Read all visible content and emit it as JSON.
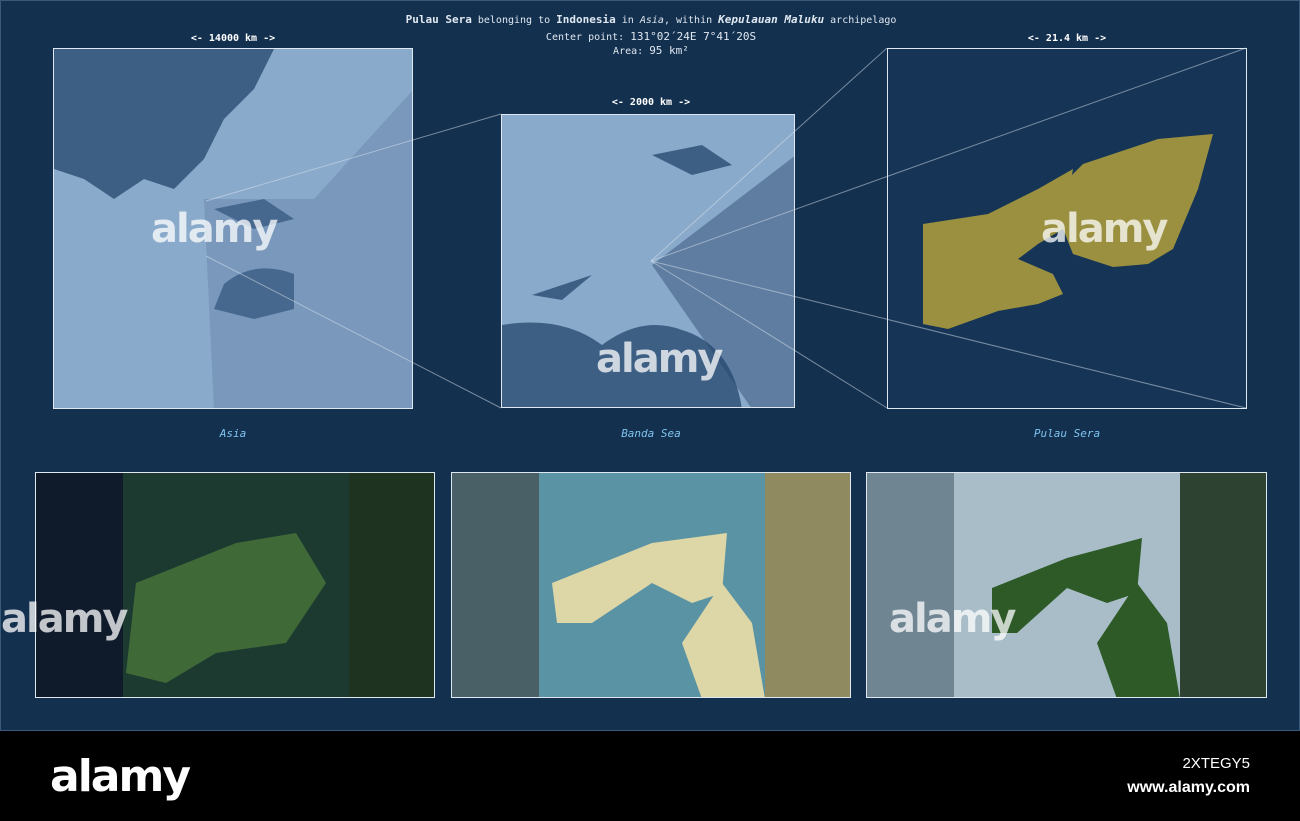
{
  "header": {
    "name": "Pulau Sera",
    "t1": "belonging to",
    "country": "Indonesia",
    "t2": "in",
    "continent": "Asia",
    "t3": ", within",
    "archipelago": "Kepulauan Maluku",
    "t4": "archipelago",
    "center_label": "Center point:",
    "center_value": "131°02´24E  7°41´20S",
    "area_label": "Area:",
    "area_value": "95 km²"
  },
  "maps": [
    {
      "scale": "<-   14000 km   ->",
      "caption": "Asia"
    },
    {
      "scale": "<-   2000 km   ->",
      "caption": "Banda Sea"
    },
    {
      "scale": "<-   21.4 km   ->",
      "caption": "Pulau Sera"
    }
  ],
  "watermark": "alamy",
  "footer": {
    "logo": "alamy",
    "image_id": "2XTEGY5",
    "site": "www.alamy.com"
  },
  "colors": {
    "bg": "#14304f",
    "land_highlight": "#9a9040",
    "sea_light": "#8aaacb"
  }
}
